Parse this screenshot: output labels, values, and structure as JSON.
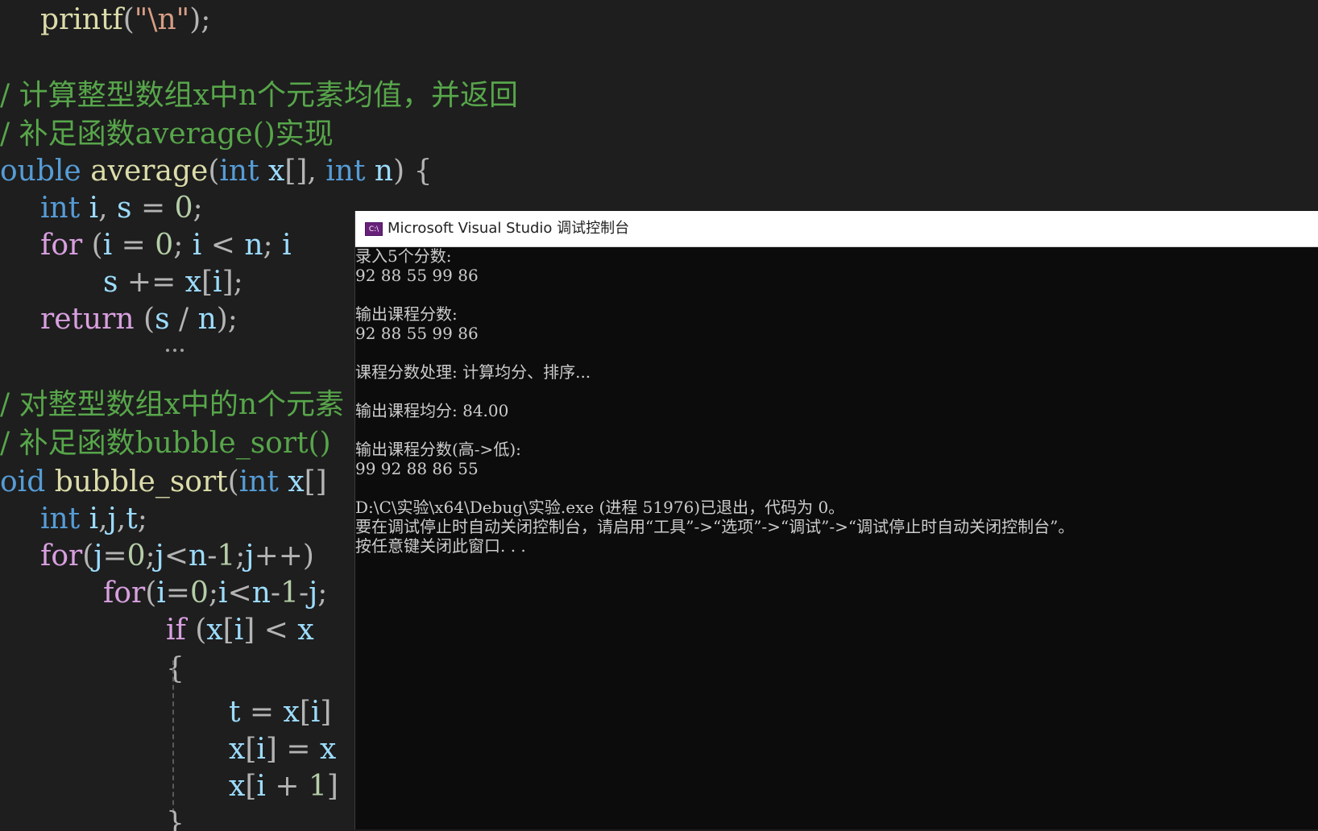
{
  "editor": {
    "lines": {
      "l1": {
        "fn": "printf",
        "open": "(",
        "str": "\"\\n\"",
        "close": ");"
      },
      "l2": {
        "text": "/ 计算整型数组x中n个元素均值，并返回"
      },
      "l3": {
        "text": "/ 补足函数average()实现"
      },
      "l4": {
        "kw": "ouble",
        "fn": "average",
        "p1": "(",
        "kw2": "int",
        "v1": "x",
        "p2": "[], ",
        "kw3": "int",
        "v2": "n",
        "p3": ") {"
      },
      "l5": {
        "kw": "int",
        "v1": "i",
        "p1": ", ",
        "v2": "s",
        "p2": " = ",
        "num": "0",
        "p3": ";"
      },
      "l6": {
        "ctl": "for",
        "p1": " (",
        "v1": "i",
        "p2": " = ",
        "num": "0",
        "p3": "; ",
        "v2": "i",
        "p4": " < ",
        "v3": "n",
        "p5": "; ",
        "v4": "i"
      },
      "l7": {
        "v1": "s",
        "p1": " += ",
        "v2": "x",
        "p2": "[",
        "v3": "i",
        "p3": "];"
      },
      "l8": {
        "ctl": "return",
        "p1": " (",
        "v1": "s",
        "p2": " / ",
        "v2": "n",
        "p3": ");"
      },
      "l9": {
        "text": "/ 对整型数组x中的n个元素"
      },
      "l10": {
        "text": "/ 补足函数bubble_sort()"
      },
      "l11": {
        "kw": "oid",
        "fn": "bubble_sort",
        "p1": "(",
        "kw2": "int",
        "v1": "x",
        "p2": "[]"
      },
      "l12": {
        "kw": "int",
        "v1": "i",
        "p1": ",",
        "v2": "j",
        "p2": ",",
        "v3": "t",
        "p3": ";"
      },
      "l13": {
        "ctl": "for",
        "p1": "(",
        "v1": "j",
        "p2": "=",
        "num": "0",
        "p3": ";",
        "v2": "j",
        "p4": "<",
        "v3": "n",
        "p5": "-",
        "num2": "1",
        "p6": ";",
        "v4": "j",
        "p7": "++)"
      },
      "l14": {
        "ctl": "for",
        "p1": "(",
        "v1": "i",
        "p2": "=",
        "num": "0",
        "p3": ";",
        "v2": "i",
        "p4": "<",
        "v3": "n",
        "p5": "-",
        "num2": "1",
        "p6": "-",
        "v4": "j",
        "p7": ";"
      },
      "l15": {
        "ctl": "if",
        "p1": " (",
        "v1": "x",
        "p2": "[",
        "v2": "i",
        "p3": "] < ",
        "v3": "x"
      },
      "l16": {
        "p1": "{"
      },
      "l17": {
        "v1": "t",
        "p1": " = ",
        "v2": "x",
        "p2": "[",
        "v3": "i",
        "p3": "]"
      },
      "l18": {
        "v1": "x",
        "p1": "[",
        "v2": "i",
        "p2": "] = ",
        "v3": "x"
      },
      "l19": {
        "v1": "x",
        "p1": "[",
        "v2": "i",
        "p2": " + ",
        "num": "1",
        "p3": "]"
      },
      "l20": {
        "p1": "}"
      }
    }
  },
  "console": {
    "title": "Microsoft Visual Studio 调试控制台",
    "icon_text": "C:\\",
    "lines": [
      "录入5个分数:",
      "92 88 55 99 86",
      "",
      "输出课程分数:",
      "92 88 55 99 86",
      "",
      "课程分数处理: 计算均分、排序...",
      "",
      "输出课程均分: 84.00",
      "",
      "输出课程分数(高->低):",
      "99 92 88 86 55",
      "",
      "D:\\C\\实验\\x64\\Debug\\实验.exe (进程 51976)已退出，代码为 0。",
      "要在调试停止时自动关闭控制台，请启用“工具”->“选项”->“调试”->“调试停止时自动关闭控制台”。",
      "按任意键关闭此窗口. . ."
    ]
  },
  "colors": {
    "editor_bg": "#1e1e1e",
    "keyword": "#569cd6",
    "control": "#d8a0df",
    "function": "#dcdcaa",
    "variable": "#9cdcfe",
    "number": "#b5cea8",
    "string": "#d69d85",
    "comment": "#57a64a",
    "console_bg": "#0c0c0c",
    "console_text": "#cccccc"
  }
}
